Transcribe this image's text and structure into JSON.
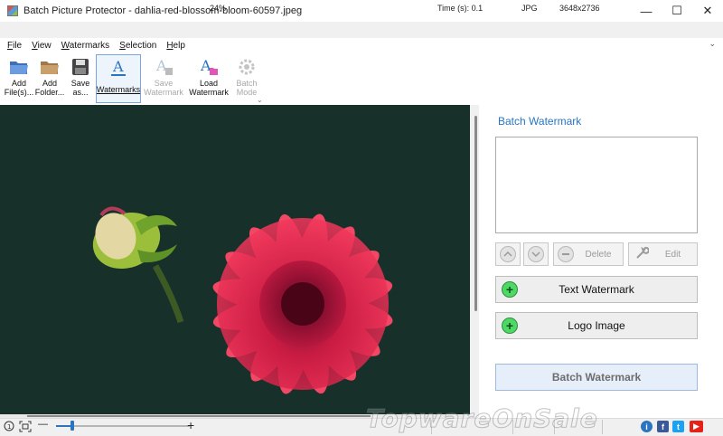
{
  "window": {
    "title": "Batch Picture Protector - dahlia-red-blossom-bloom-60597.jpeg",
    "minimize": "—",
    "maximize": "☐",
    "close": "✕"
  },
  "menu": {
    "items": [
      "File",
      "View",
      "Watermarks",
      "Selection",
      "Help"
    ],
    "pin": "⌄"
  },
  "toolbar": {
    "add_files": [
      "Add",
      "File(s)..."
    ],
    "add_folder": [
      "Add",
      "Folder..."
    ],
    "save_as": [
      "Save",
      "as..."
    ],
    "watermarks": "Watermarks",
    "save_watermark": [
      "Save",
      "Watermark"
    ],
    "load_watermark": [
      "Load",
      "Watermark"
    ],
    "batch_mode": [
      "Batch",
      "Mode"
    ],
    "more": "⌄"
  },
  "panel": {
    "title": "Batch Watermark",
    "delete_label": "Delete",
    "edit_label": "Edit",
    "text_watermark_label": "Text Watermark",
    "logo_image_label": "Logo Image",
    "batch_watermark_label": "Batch Watermark"
  },
  "statusbar": {
    "zoom_minus": "—",
    "zoom_plus": "+",
    "zoom_level": "24%",
    "zoom_fraction": 0.24,
    "time": "Time (s): 0.1",
    "format": "JPG",
    "dimensions": "3648x2736",
    "info": "i",
    "facebook": "f",
    "twitter": "t",
    "youtube": "▶"
  },
  "overlay_watermark": "TopwareOnSale",
  "colors": {
    "accent": "#2a74c0",
    "canvas_bg": "#17302a",
    "green_plus": "#4cd964"
  }
}
